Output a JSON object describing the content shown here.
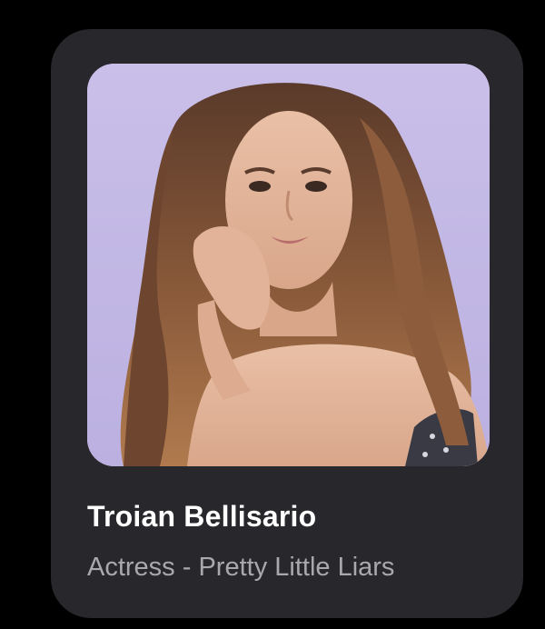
{
  "profile_card": {
    "name": "Troian Bellisario",
    "subtitle": "Actress - Pretty Little Liars",
    "photo_alt": "Portrait photo"
  },
  "colors": {
    "page_background": "#000000",
    "card_background": "#28272b",
    "photo_background": "#c2b7e6",
    "name_text": "#ffffff",
    "subtitle_text": "#a9a8ad"
  }
}
